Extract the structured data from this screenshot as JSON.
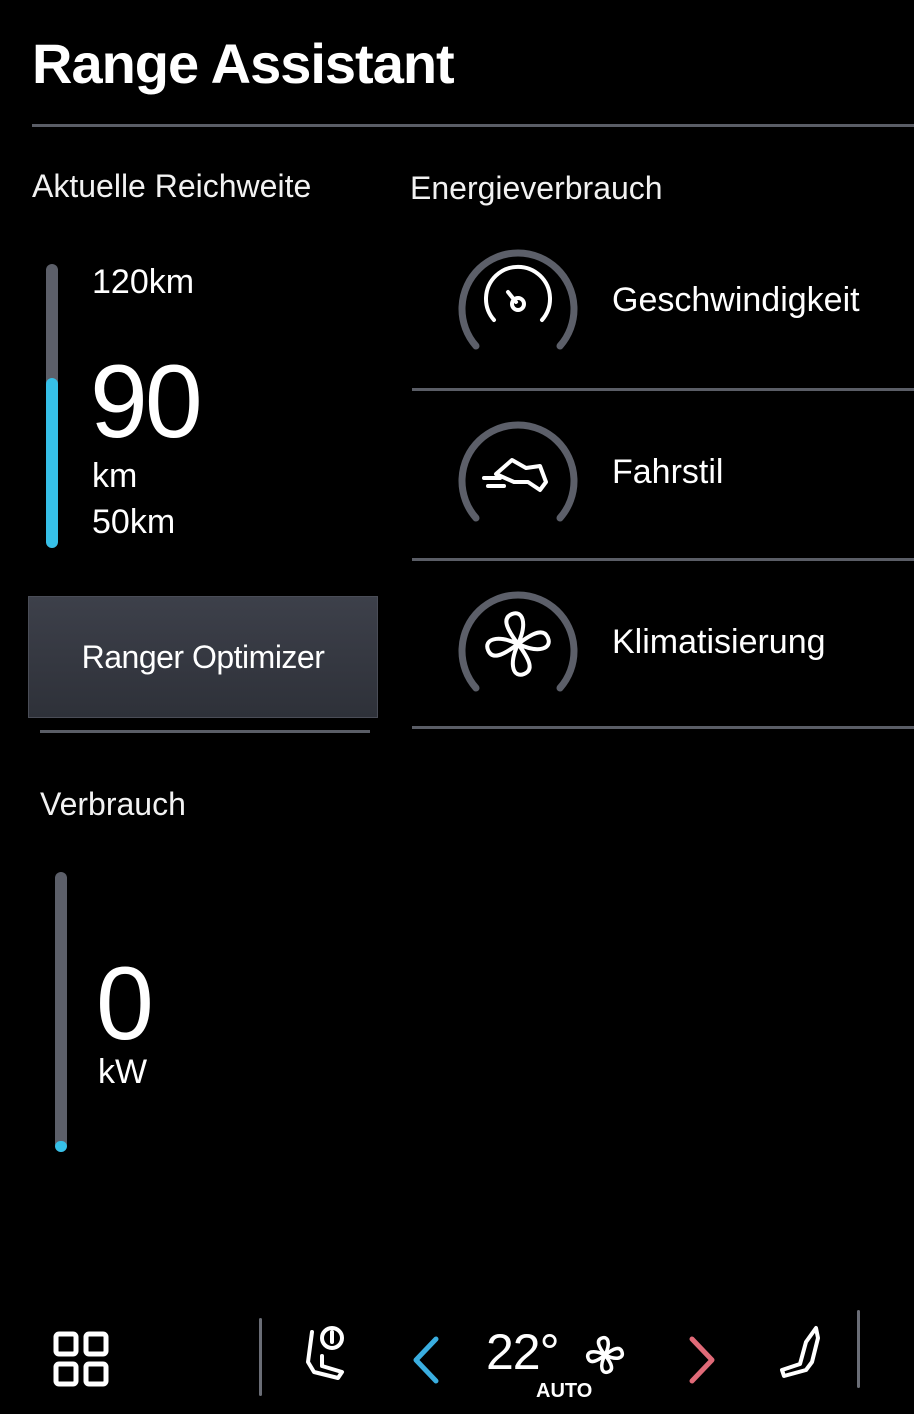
{
  "header": {
    "title": "Range Assistant"
  },
  "range": {
    "heading": "Aktuelle Reichweite",
    "max_label": "120km",
    "value": "90",
    "unit": "km",
    "min_label": "50km",
    "fill_fraction": 0.6
  },
  "optimizer": {
    "label": "Ranger Optimizer"
  },
  "consumption": {
    "heading": "Verbrauch",
    "value": "0",
    "unit": "kW",
    "fill_fraction": 0.04
  },
  "energy": {
    "heading": "Energieverbrauch",
    "items": [
      {
        "label": "Geschwindigkeit",
        "icon": "speedometer-icon"
      },
      {
        "label": "Fahrstil",
        "icon": "driving-style-icon"
      },
      {
        "label": "Klimatisierung",
        "icon": "fan-icon"
      }
    ]
  },
  "bottom_bar": {
    "temperature": "22°",
    "climate_mode": "AUTO",
    "left_arrow_color": "#3aaee0",
    "right_arrow_color": "#e06a78"
  },
  "colors": {
    "accent": "#36c0e8",
    "track": "#5c5f69",
    "divider": "#5a5d66",
    "background": "#000000"
  }
}
